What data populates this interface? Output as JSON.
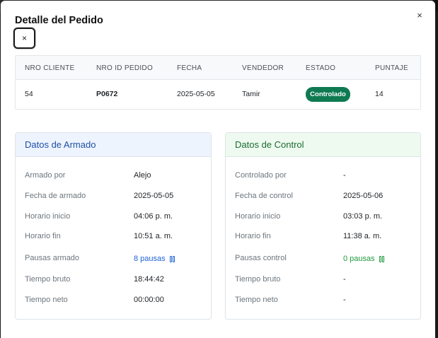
{
  "modal": {
    "title": "Detalle del Pedido",
    "header_close_glyph": "×",
    "focus_close_glyph": "×"
  },
  "order_table": {
    "headers": [
      "NRO CLIENTE",
      "NRO ID PEDIDO",
      "FECHA",
      "VENDEDOR",
      "ESTADO",
      "PUNTAJE"
    ],
    "row": {
      "cliente": "54",
      "pedido": "P0672",
      "fecha": "2025-05-05",
      "vendedor": "Tamir",
      "estado": "Controlado",
      "puntaje": "14"
    },
    "estado_color": "#0f7a52"
  },
  "armado": {
    "title": "Datos de Armado",
    "rows": [
      {
        "label": "Armado por",
        "value": "Alejo"
      },
      {
        "label": "Fecha de armado",
        "value": "2025-05-05"
      },
      {
        "label": "Horario inicio",
        "value": "04:06 p. m."
      },
      {
        "label": "Horario fin",
        "value": "10:51 a. m."
      },
      {
        "label": "Pausas armado",
        "value": "8 pausas"
      },
      {
        "label": "Tiempo bruto",
        "value": "18:44:42"
      },
      {
        "label": "Tiempo neto",
        "value": "00:00:00"
      }
    ],
    "accent": "#1f4fa6"
  },
  "control": {
    "title": "Datos de Control",
    "rows": [
      {
        "label": "Controlado por",
        "value": "-"
      },
      {
        "label": "Fecha de control",
        "value": "2025-05-06"
      },
      {
        "label": "Horario inicio",
        "value": "03:03 p. m."
      },
      {
        "label": "Horario fin",
        "value": "11:38 a. m."
      },
      {
        "label": "Pausas control",
        "value": "0 pausas"
      },
      {
        "label": "Tiempo bruto",
        "value": "-"
      },
      {
        "label": "Tiempo neto",
        "value": "-"
      }
    ],
    "accent": "#1b6b2f"
  }
}
